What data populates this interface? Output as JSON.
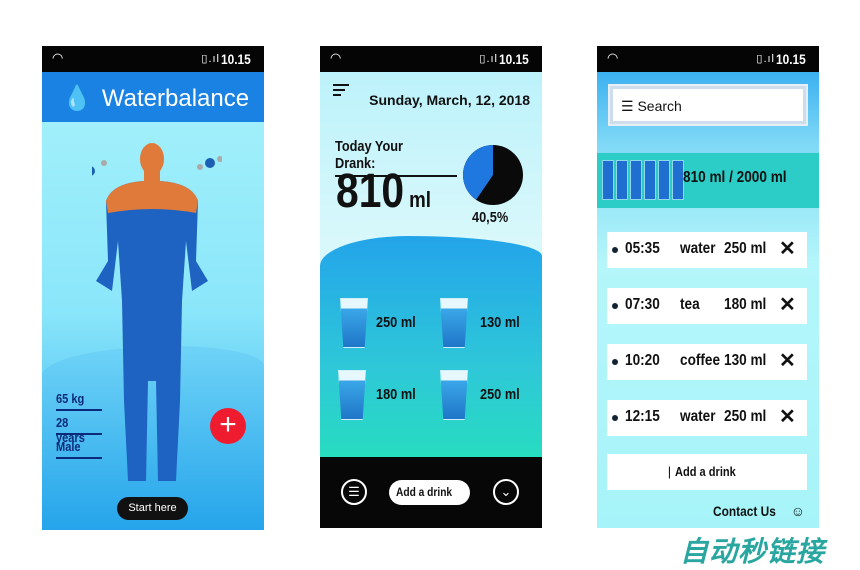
{
  "status": {
    "time": "10.15"
  },
  "screen1": {
    "title": "Waterbalance",
    "weight": "65 kg",
    "age": "28 years",
    "gender": "Male",
    "start_label": "Start here",
    "add_icon": "plus-icon"
  },
  "screen2": {
    "date": "Sunday, March, 12, 2018",
    "today_label": "Today Your Drank:",
    "amount": "810",
    "unit": "ml",
    "percent_label": "40,5%",
    "percent": 40.5,
    "glasses": [
      "250 ml",
      "130 ml",
      "180 ml",
      "250 ml"
    ],
    "add_label": "Add a drink"
  },
  "screen3": {
    "search_label": "Search",
    "progress_label": "810 ml / 2000 ml",
    "progress": 0.405,
    "entries": [
      {
        "time": "05:35",
        "drink": "water",
        "amount": "250 ml"
      },
      {
        "time": "07:30",
        "drink": "tea",
        "amount": "180 ml"
      },
      {
        "time": "10:20",
        "drink": "coffee",
        "amount": "130 ml"
      },
      {
        "time": "12:15",
        "drink": "water",
        "amount": "250 ml"
      }
    ],
    "add_label": "Add a drink",
    "contact_label": "Contact Us"
  },
  "watermark": "自动秒链接",
  "colors": {
    "accent": "#1a82e3",
    "add": "#ee1c2e",
    "teal": "#2bcdc6"
  }
}
